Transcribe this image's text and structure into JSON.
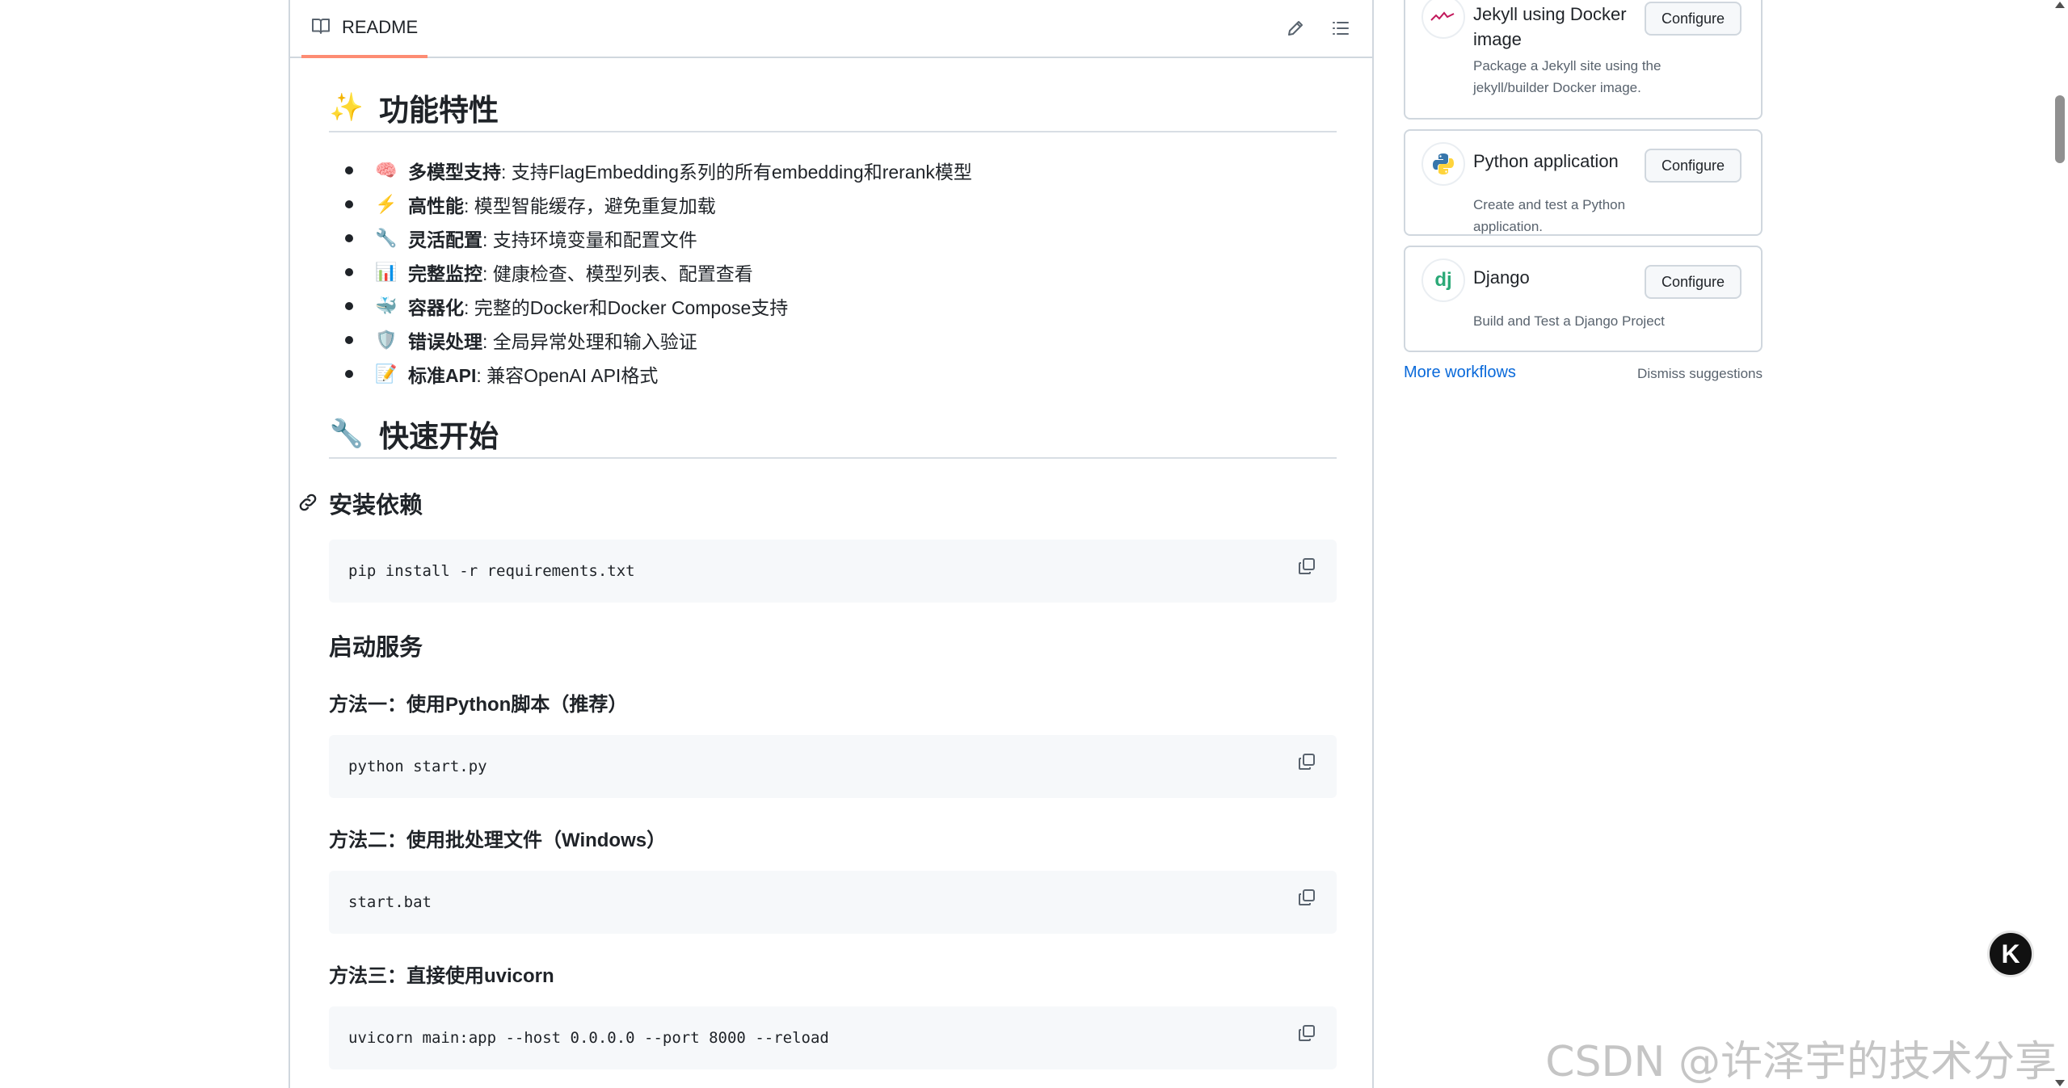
{
  "readme": {
    "tab_label": "README",
    "features_heading": {
      "emoji": "✨",
      "title": "功能特性"
    },
    "features": [
      {
        "emoji": "🧠",
        "bold": "多模型支持",
        "text": ": 支持FlagEmbedding系列的所有embedding和rerank模型"
      },
      {
        "emoji": "⚡",
        "bold": "高性能",
        "text": ": 模型智能缓存，避免重复加载"
      },
      {
        "emoji": "🔧",
        "bold": "灵活配置",
        "text": ": 支持环境变量和配置文件"
      },
      {
        "emoji": "📊",
        "bold": "完整监控",
        "text": ": 健康检查、模型列表、配置查看"
      },
      {
        "emoji": "🐳",
        "bold": "容器化",
        "text": ": 完整的Docker和Docker Compose支持"
      },
      {
        "emoji": "🛡️",
        "bold": "错误处理",
        "text": ": 全局异常处理和输入验证"
      },
      {
        "emoji": "📝",
        "bold": "标准API",
        "text": ": 兼容OpenAI API格式"
      }
    ],
    "quickstart_heading": {
      "emoji": "🔧",
      "title": "快速开始"
    },
    "install_heading": "安装依赖",
    "install_code": "pip install -r requirements.txt",
    "start_heading": "启动服务",
    "method1_heading": "方法一：使用Python脚本（推荐）",
    "method1_code": "python start.py",
    "method2_heading": "方法二：使用批处理文件（Windows）",
    "method2_code": "start.bat",
    "method3_heading": "方法三：直接使用uvicorn",
    "method3_code": "uvicorn main:app --host 0.0.0.0 --port 8000 --reload"
  },
  "sidebar": {
    "workflows": [
      {
        "title": "Jekyll using Docker image",
        "description": "Package a Jekyll site using the jekyll/builder Docker image.",
        "button": "Configure",
        "icon": "jekyll-icon"
      },
      {
        "title": "Python application",
        "description": "Create and test a Python application.",
        "button": "Configure",
        "icon": "python-icon"
      },
      {
        "title": "Django",
        "description": "Build and Test a Django Project",
        "button": "Configure",
        "icon": "django-icon",
        "logo_text": "dj"
      }
    ],
    "more_workflows": "More workflows",
    "dismiss": "Dismiss suggestions"
  },
  "floating_button": {
    "label": "K"
  },
  "watermark": "CSDN @许泽宇的技术分享",
  "colors": {
    "link": "#0969da",
    "tab_underline": "#fd8c73",
    "code_bg": "#f6f8fa",
    "django_green": "#2ba977"
  }
}
